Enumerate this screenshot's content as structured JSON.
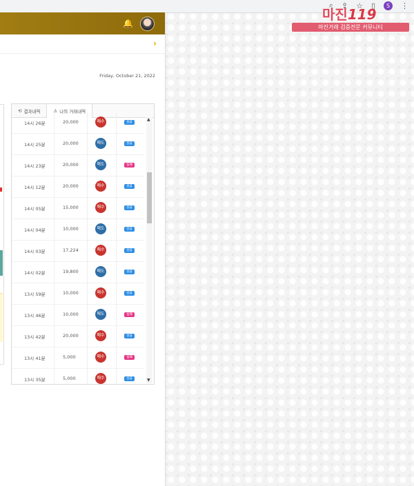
{
  "watermark": {
    "title": "마진",
    "number": "119",
    "subtitle": "마진거래 검증전문 커뮤니티"
  },
  "browser": {
    "profile": "S"
  },
  "page": {
    "date": "Friday, October 21, 2022"
  },
  "tabs": [
    {
      "icon": "history-icon",
      "label": "결과내역"
    },
    {
      "icon": "user-icon",
      "label": "나의 거래내역"
    }
  ],
  "colors": {
    "buy": "#c9342f",
    "sell": "#2e6ea7",
    "win": "#2f8ee6",
    "loss": "#e53986"
  },
  "rows": [
    {
      "time": "14시 26분",
      "amount": "20,000",
      "side": "매수",
      "result": "성공"
    },
    {
      "time": "14시 25분",
      "amount": "20,000",
      "side": "매도",
      "result": "성공"
    },
    {
      "time": "14시 23분",
      "amount": "20,000",
      "side": "매도",
      "result": "실패"
    },
    {
      "time": "14시 12분",
      "amount": "20,000",
      "side": "매수",
      "result": "성공"
    },
    {
      "time": "14시 05분",
      "amount": "15,000",
      "side": "매수",
      "result": "성공"
    },
    {
      "time": "14시 04분",
      "amount": "10,000",
      "side": "매도",
      "result": "성공"
    },
    {
      "time": "14시 03분",
      "amount": "17,224",
      "side": "매수",
      "result": "성공"
    },
    {
      "time": "14시 02분",
      "amount": "19,800",
      "side": "매도",
      "result": "성공"
    },
    {
      "time": "13시 59분",
      "amount": "10,000",
      "side": "매수",
      "result": "성공"
    },
    {
      "time": "13시 46분",
      "amount": "10,000",
      "side": "매도",
      "result": "실패"
    },
    {
      "time": "13시 42분",
      "amount": "20,000",
      "side": "매수",
      "result": "성공"
    },
    {
      "time": "13시 41분",
      "amount": "5,000",
      "side": "매수",
      "result": "실패"
    },
    {
      "time": "13시 35분",
      "amount": "5,000",
      "side": "매수",
      "result": "성공"
    }
  ]
}
